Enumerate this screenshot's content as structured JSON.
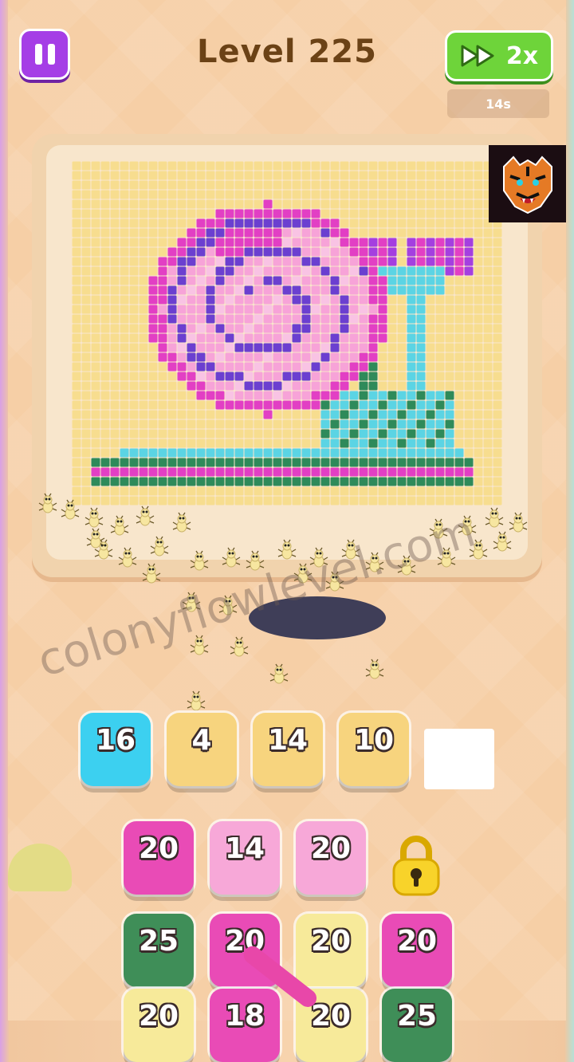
{
  "header": {
    "level_title": "Level 225",
    "speed_label": "2x",
    "timer": "14s"
  },
  "icons": {
    "pause": "pause-icon",
    "fast_forward": "fast-forward-icon",
    "lock": "padlock-icon",
    "badge": "tiger-logo"
  },
  "board": {
    "image": "pixel-art-snail",
    "colors": {
      "cream": "#f7dd8f",
      "magenta": "#e23fc4",
      "pink": "#f7a3d8",
      "light_pink": "#f9c3e4",
      "purple": "#6b3fd0",
      "cyan": "#5bd4e4",
      "green": "#2e8a5a",
      "violet": "#a43fe0"
    }
  },
  "watermark": "colonyflowlevel.com",
  "queue": [
    {
      "value": "16",
      "color": "#3cd0f0"
    },
    {
      "value": "4",
      "color": "#f7d47e"
    },
    {
      "value": "14",
      "color": "#f7d47e"
    },
    {
      "value": "10",
      "color": "#f7d47e"
    }
  ],
  "stack_rows": [
    [
      {
        "value": "20",
        "color": "#e94bb6"
      },
      {
        "value": "14",
        "color": "#f7a8d8"
      },
      {
        "value": "20",
        "color": "#f7a8d8"
      }
    ],
    [
      {
        "value": "25",
        "color": "#3f8e58"
      },
      {
        "value": "20",
        "color": "#e94bb6"
      },
      {
        "value": "20",
        "color": "#f7ea9a"
      },
      {
        "value": "20",
        "color": "#e94bb6"
      }
    ],
    [
      {
        "value": "20",
        "color": "#f7ea9a"
      },
      {
        "value": "18",
        "color": "#e94bb6"
      },
      {
        "value": "20",
        "color": "#f7ea9a"
      },
      {
        "value": "25",
        "color": "#3f8e58"
      }
    ]
  ]
}
